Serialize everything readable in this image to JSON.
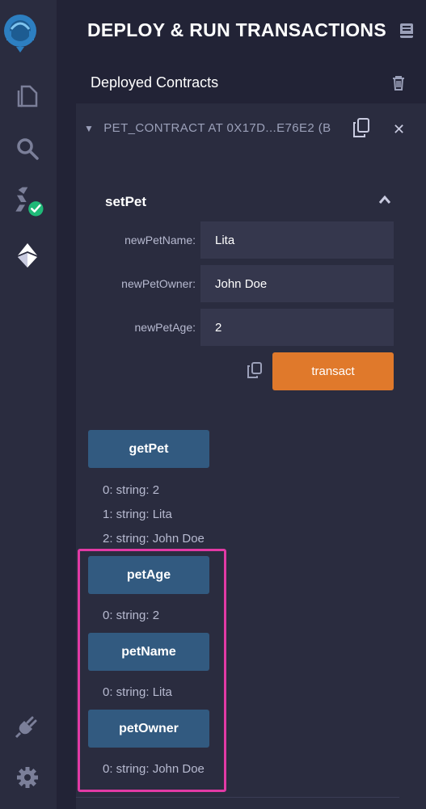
{
  "iconbar": {
    "items": [
      "remix-logo-icon",
      "file-explorer-icon",
      "search-icon",
      "solidity-compiler-icon",
      "deploy-run-icon",
      "plugin-manager-icon",
      "settings-icon"
    ]
  },
  "panel": {
    "title": "DEPLOY & RUN TRANSACTIONS",
    "section_label": "Deployed Contracts"
  },
  "contract": {
    "header": "PET_CONTRACT AT 0X17D...E76E2 (B",
    "function": {
      "name": "setPet",
      "params": [
        {
          "label": "newPetName:",
          "value": "Lita"
        },
        {
          "label": "newPetOwner:",
          "value": "John Doe"
        },
        {
          "label": "newPetAge:",
          "value": "2"
        }
      ],
      "transact_label": "transact"
    },
    "calls": [
      {
        "label": "getPet",
        "outputs": [
          "0: string: 2",
          "1: string: Lita",
          "2: string: John Doe"
        ]
      },
      {
        "label": "petAge",
        "outputs": [
          "0: string: 2"
        ]
      },
      {
        "label": "petName",
        "outputs": [
          "0: string: Lita"
        ]
      },
      {
        "label": "petOwner",
        "outputs": [
          "0: string: John Doe"
        ]
      }
    ]
  },
  "colors": {
    "accent_orange": "#e0792b",
    "call_button": "#325a80",
    "highlight": "#e23aa5",
    "success_green": "#1fb978"
  }
}
